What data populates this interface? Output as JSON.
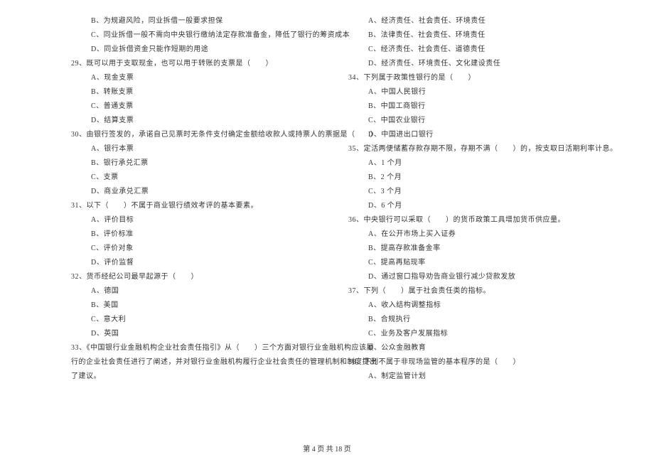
{
  "left_column": {
    "pre_options": [
      "B、为规避风险，同业拆借一般要求担保",
      "C、同业拆借一般不需向中央银行缴纳法定存款准备金，降低了银行的筹资成本",
      "D、同业拆借资金只能作短期的用途"
    ],
    "q29": {
      "text": "29、既可以用于支取现金，也可以用于转账的支票是（　　）",
      "options": [
        "A、现金支票",
        "B、转账支票",
        "C、普通支票",
        "D、结算支票"
      ]
    },
    "q30": {
      "text": "30、由银行签发的，承诺自己见票时无条件支付确定金额给收款人或持票人的票据是（　　）",
      "options": [
        "A、银行本票",
        "B、银行承兑汇票",
        "C、支票",
        "D、商业承兑汇票"
      ]
    },
    "q31": {
      "text": "31、以下（　　）不属于商业银行绩效考评的基本要素。",
      "options": [
        "A、评价目标",
        "B、评价标准",
        "C、评价对象",
        "D、评价监督"
      ]
    },
    "q32": {
      "text": "32、货币经纪公司最早起源于（　　）",
      "options": [
        "A、德国",
        "B、美国",
        "C、意大利",
        "D、英国"
      ]
    },
    "q33": {
      "line1": "33、《中国银行业金融机构企业社会责任指引》从（　　）三个方面对银行业金融机构应该履",
      "line2": "行的企业社会责任进行了阐述，并对银行业金融机构履行企业社会责任的管理机制和制度提出",
      "line3": "了建议。"
    }
  },
  "right_column": {
    "q33_options": [
      "A、经济责任、社会责任、环境责任",
      "B、法律责任、社会责任、环境责任",
      "C、经济责任、社会责任、道德责任",
      "D、经济责任、环境责任、文化建设责任"
    ],
    "q34": {
      "text": "34、下列属于政策性银行的是（　　）",
      "options": [
        "A、中国人民银行",
        "B、中国工商银行",
        "C、中国农业银行",
        "D、中国进出口银行"
      ]
    },
    "q35": {
      "text": "35、定活两便储蓄存款存期不限，存期不满（　　）的，按支取日活期利率计息。",
      "options": [
        "A、1 个月",
        "B、2 个月",
        "C、3 个月",
        "D、6 个月"
      ]
    },
    "q36": {
      "text": "36、中央银行可以采取（　　）的货币政策工具增加货币供应量。",
      "options": [
        "A、在公开市场上买入证券",
        "B、提高存款准备金率",
        "C、提高再贴现率",
        "D、通过窗口指导劝告商业银行减少贷款发放"
      ]
    },
    "q37": {
      "text": "37、下列（　　）属于社会责任类的指标。",
      "options": [
        "A、收入结构调整指标",
        "B、合规执行",
        "C、业务及客户发展指标",
        "D、公众金融教育"
      ]
    },
    "q38": {
      "text": "38、下列不属于非现场监管的基本程序的是（　　）",
      "options": [
        "A、制定监管计划"
      ]
    }
  },
  "footer": "第 4 页 共 18 页"
}
